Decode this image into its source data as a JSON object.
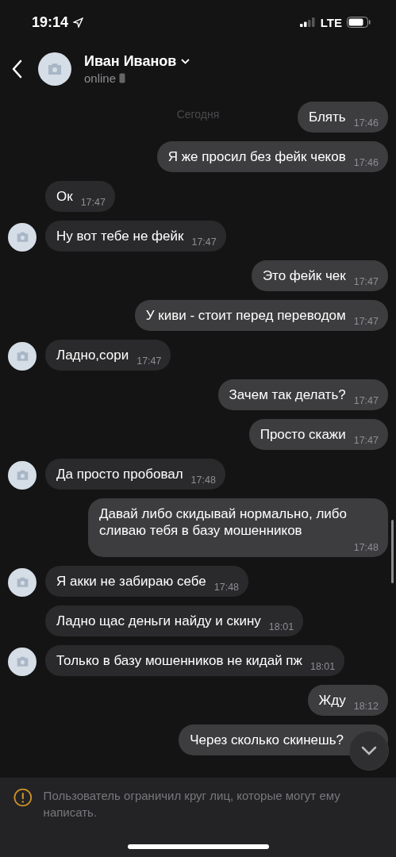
{
  "status_bar": {
    "time": "19:14",
    "network": "LTE"
  },
  "header": {
    "name": "Иван Иванов",
    "status": "online"
  },
  "date_label": "Сегодня",
  "messages": [
    {
      "kind": "outgoing",
      "text": "Блять",
      "time": "17:46"
    },
    {
      "kind": "outgoing",
      "text": "Я же просил без фейк чеков",
      "time": "17:46"
    },
    {
      "kind": "incoming",
      "text": "Ок",
      "time": "17:47",
      "avatar": false
    },
    {
      "kind": "incoming",
      "text": "Ну вот тебе не фейк",
      "time": "17:47",
      "avatar": true
    },
    {
      "kind": "outgoing",
      "text": "Это фейк чек",
      "time": "17:47"
    },
    {
      "kind": "outgoing",
      "text": "У киви - стоит перед переводом",
      "time": "17:47"
    },
    {
      "kind": "incoming",
      "text": "Ладно,сори",
      "time": "17:47",
      "avatar": true
    },
    {
      "kind": "outgoing",
      "text": "Зачем так делать?",
      "time": "17:47"
    },
    {
      "kind": "outgoing",
      "text": "Просто скажи",
      "time": "17:47"
    },
    {
      "kind": "incoming",
      "text": "Да просто пробовал",
      "time": "17:48",
      "avatar": true
    },
    {
      "kind": "outgoing",
      "text": "Давай либо скидывай нормально, либо сливаю тебя в базу мошенников",
      "time": "17:48"
    },
    {
      "kind": "incoming",
      "text": "Я акки не забираю себе",
      "time": "17:48",
      "avatar": true
    },
    {
      "kind": "incoming",
      "text": "Ладно щас деньги найду и скину",
      "time": "18:01",
      "avatar": false
    },
    {
      "kind": "incoming",
      "text": "Только в базу мошенников не кидай пж",
      "time": "18:01",
      "avatar": true
    },
    {
      "kind": "outgoing",
      "text": "Жду",
      "time": "18:12"
    },
    {
      "kind": "outgoing",
      "text": "Через сколько скинешь?"
    }
  ],
  "notice": "Пользователь ограничил круг лиц, которые могут ему написать."
}
